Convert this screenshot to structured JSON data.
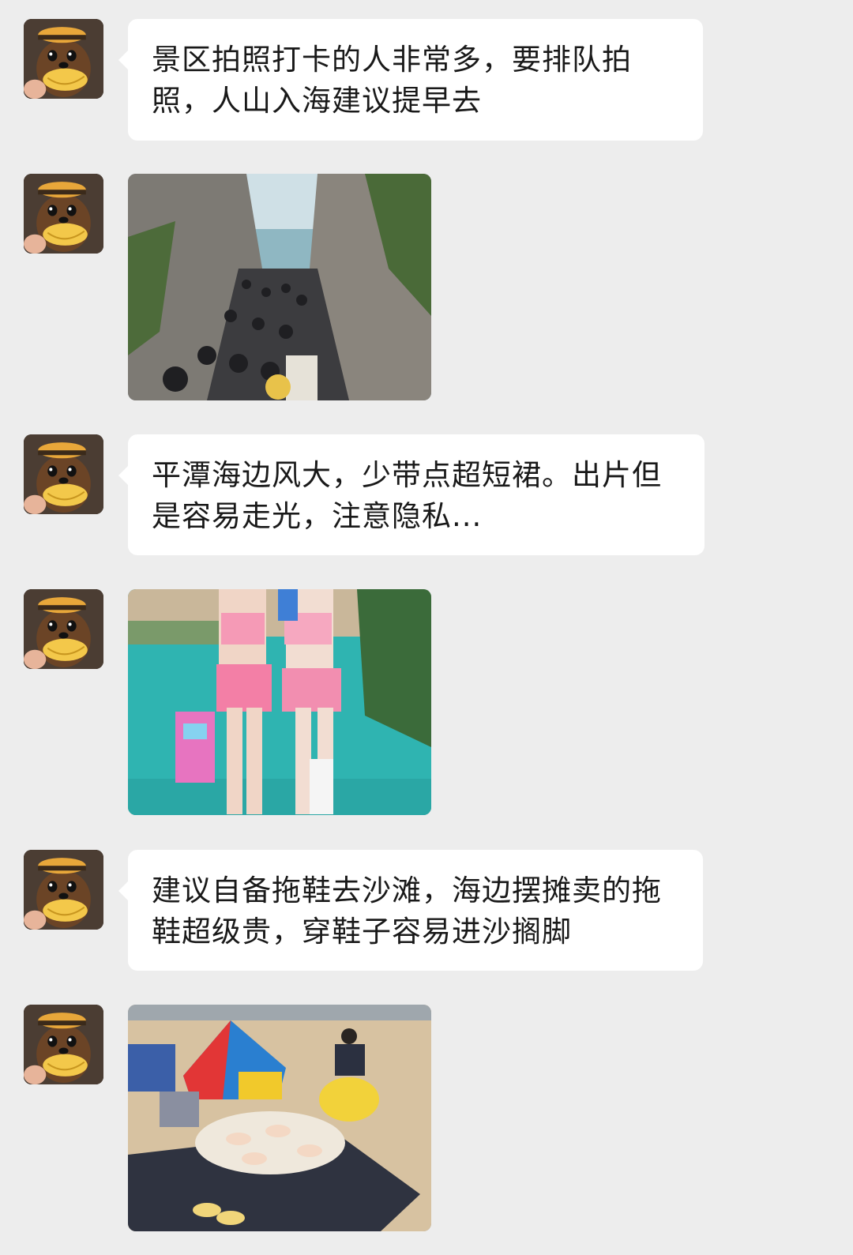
{
  "chat": {
    "messages": [
      {
        "type": "text",
        "text": "景区拍照打卡的人非常多，要排队拍照，人山入海建议提早去"
      },
      {
        "type": "image",
        "icon": "crowd-canyon-photo"
      },
      {
        "type": "text",
        "text": "平潭海边风大，少带点超短裙。出片但是容易走光，注意隐私..."
      },
      {
        "type": "image",
        "icon": "pink-outfit-poolside-photo"
      },
      {
        "type": "text",
        "text": "建议自备拖鞋去沙滩，海边摆摊卖的拖鞋超级贵，穿鞋子容易进沙搁脚"
      },
      {
        "type": "image",
        "icon": "beach-slipper-vendor-photo"
      }
    ],
    "avatar_icon": "dog-with-hat-avatar"
  },
  "colors": {
    "background": "#ededed",
    "bubble": "#ffffff",
    "text": "#191919"
  }
}
